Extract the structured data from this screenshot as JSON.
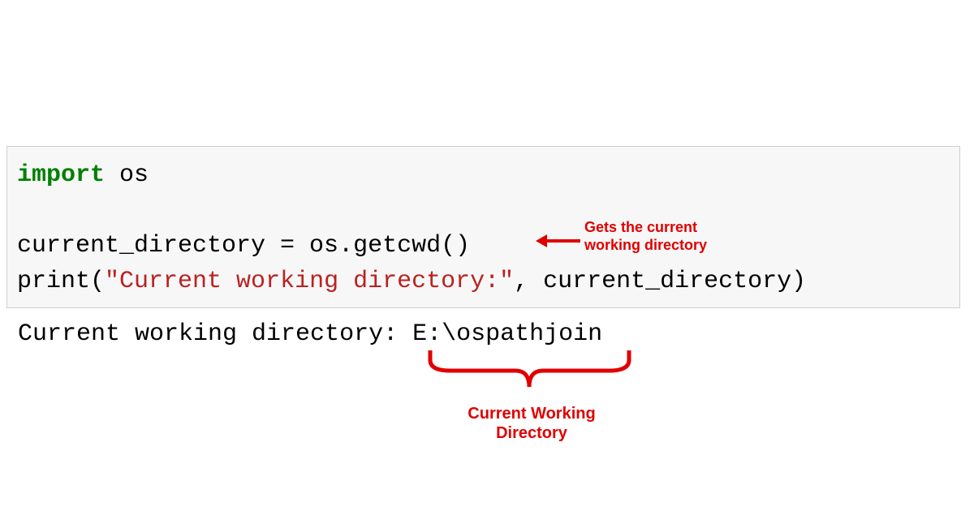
{
  "code": {
    "line1_kw": "import",
    "line1_rest": " os",
    "line2_prefix": "current_directory = os.getcwd()",
    "line3_pre": "print(",
    "line3_str": "\"Current working directory:\"",
    "line3_post": ", current_directory)"
  },
  "output": {
    "text": "Current working directory: E:\\ospathjoin"
  },
  "annotations": {
    "a1_line1": "Gets the current",
    "a1_line2": "working directory",
    "a2_line1": "Current Working",
    "a2_line2": "Directory"
  },
  "colors": {
    "red": "#e00000",
    "keyword": "#008000",
    "string": "#ba2121"
  }
}
